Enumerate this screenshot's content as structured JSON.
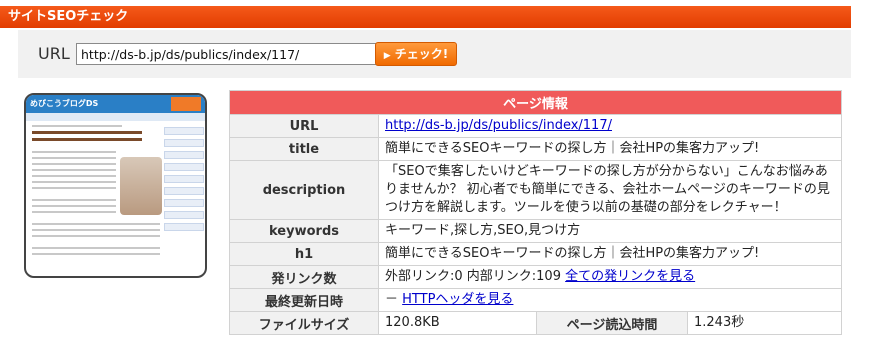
{
  "header": {
    "title": "サイトSEOチェック"
  },
  "url_bar": {
    "label": "URL",
    "value": "http://ds-b.jp/ds/publics/index/117/",
    "button": "チェック!"
  },
  "thumbnail": {
    "site_logo": "めびこうブログDS"
  },
  "info": {
    "heading": "ページ情報",
    "rows": {
      "url": {
        "label": "URL",
        "value": "http://ds-b.jp/ds/publics/index/117/"
      },
      "title": {
        "label": "title",
        "value": "簡単にできるSEOキーワードの探し方｜会社HPの集客力アップ!"
      },
      "description": {
        "label": "description",
        "value": "「SEOで集客したいけどキーワードの探し方が分からない」こんなお悩みありませんか？ 初心者でも簡単にできる、会社ホームページのキーワードの見つけ方を解説します。ツールを使う以前の基礎の部分をレクチャー！"
      },
      "keywords": {
        "label": "keywords",
        "value": "キーワード,探し方,SEO,見つけ方"
      },
      "h1": {
        "label": "h1",
        "value": "簡単にできるSEOキーワードの探し方｜会社HPの集客力アップ!"
      },
      "links": {
        "label": "発リンク数",
        "value": "外部リンク:0 内部リンク:109",
        "link": "全ての発リンクを見る"
      },
      "modified": {
        "label": "最終更新日時",
        "value": "－",
        "link": "HTTPヘッダを見る"
      },
      "filesize": {
        "label": "ファイルサイズ",
        "value": "120.8KB",
        "load_label": "ページ読込時間",
        "load_value": "1.243秒"
      }
    }
  }
}
